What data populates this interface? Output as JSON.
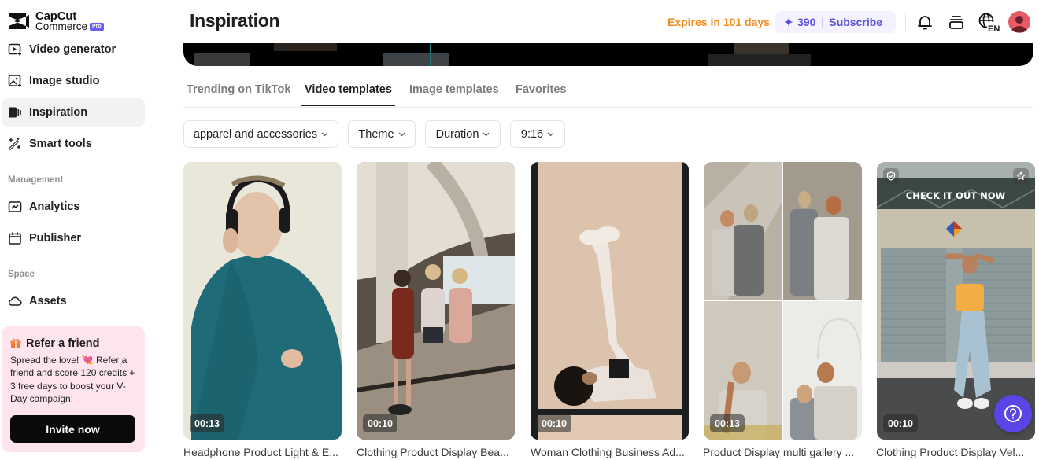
{
  "brand": {
    "name_line1": "CapCut",
    "name_line2": "Commerce",
    "badge": "Pro",
    "accent_color": "#6b5cf6"
  },
  "sidebar": {
    "items": [
      {
        "label": "Video generator",
        "icon": "video-generator-icon"
      },
      {
        "label": "Image studio",
        "icon": "image-studio-icon"
      },
      {
        "label": "Inspiration",
        "icon": "inspiration-icon",
        "active": true
      },
      {
        "label": "Smart tools",
        "icon": "magic-wand-icon"
      }
    ],
    "management_label": "Management",
    "management_items": [
      {
        "label": "Analytics",
        "icon": "analytics-icon"
      },
      {
        "label": "Publisher",
        "icon": "calendar-icon"
      }
    ],
    "space_label": "Space",
    "space_items": [
      {
        "label": "Assets",
        "icon": "cloud-icon"
      }
    ],
    "refer": {
      "title": "Refer a friend",
      "body": "Spread the love! 💘 Refer a friend and score 120 credits + 3 free days to boost your V-Day campaign!",
      "button": "Invite now"
    }
  },
  "header": {
    "title": "Inspiration",
    "expires": "Expires in 101 days",
    "credits": "390",
    "subscribe": "Subscribe",
    "language": "EN",
    "colors": {
      "expires": "#f08a1c",
      "credits": "#5b4fe0"
    }
  },
  "tabs": [
    {
      "label": "Trending on TikTok"
    },
    {
      "label": "Video templates",
      "active": true
    },
    {
      "label": "Image templates"
    },
    {
      "label": "Favorites"
    }
  ],
  "filters": [
    {
      "label": "apparel and accessories"
    },
    {
      "label": "Theme"
    },
    {
      "label": "Duration"
    },
    {
      "label": "9:16"
    }
  ],
  "templates": [
    {
      "title": "Headphone Product Light & E...",
      "duration": "00:13"
    },
    {
      "title": "Clothing Product Display Bea...",
      "duration": "00:10"
    },
    {
      "title": "Woman Clothing Business Ad...",
      "duration": "00:10"
    },
    {
      "title": "Product Display multi gallery ...",
      "duration": "00:13"
    },
    {
      "title": "Clothing Product Display Vel...",
      "duration": "00:10",
      "overlay_text": "CHECK IT OUT NOW"
    }
  ]
}
